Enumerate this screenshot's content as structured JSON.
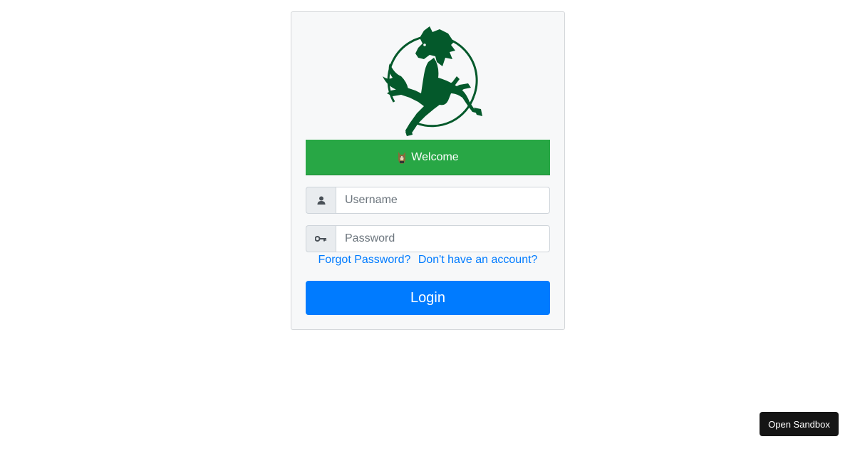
{
  "brand": {
    "logo_icon": "rearing-horse-logo",
    "logo_color": "#04592b"
  },
  "welcome": {
    "icon": "wolf-face-icon",
    "label": "Welcome",
    "color": "#28a745"
  },
  "form": {
    "username": {
      "icon": "user-icon",
      "placeholder": "Username",
      "value": ""
    },
    "password": {
      "icon": "key-icon",
      "placeholder": "Password",
      "value": ""
    }
  },
  "links": {
    "forgot_password": "Forgot Password?",
    "register": "Don't have an account?",
    "color": "#007bff"
  },
  "login_button": {
    "label": "Login",
    "color": "#007bff"
  },
  "sandbox_button": {
    "label": "Open Sandbox"
  }
}
